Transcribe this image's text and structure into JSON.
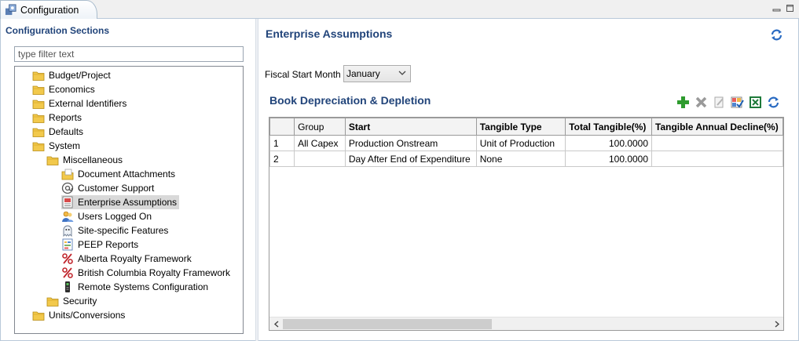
{
  "tab": {
    "label": "Configuration"
  },
  "left": {
    "section_title": "Configuration Sections",
    "filter_placeholder": "type filter text",
    "tree": [
      {
        "label": "Budget/Project",
        "icon": "folder-icon",
        "level": 0
      },
      {
        "label": "Economics",
        "icon": "folder-icon",
        "level": 0
      },
      {
        "label": "External Identifiers",
        "icon": "folder-icon",
        "level": 0
      },
      {
        "label": "Reports",
        "icon": "folder-icon",
        "level": 0
      },
      {
        "label": "Defaults",
        "icon": "folder-icon",
        "level": 0
      },
      {
        "label": "System",
        "icon": "folder-icon",
        "level": 0
      },
      {
        "label": "Miscellaneous",
        "icon": "folder-icon",
        "level": 1
      },
      {
        "label": "Document Attachments",
        "icon": "document-folder-icon",
        "level": 2
      },
      {
        "label": "Customer Support",
        "icon": "at-sign-icon",
        "level": 2
      },
      {
        "label": "Enterprise Assumptions",
        "icon": "enterprise-icon",
        "level": 2,
        "selected": true
      },
      {
        "label": "Users Logged On",
        "icon": "users-icon",
        "level": 2
      },
      {
        "label": "Site-specific Features",
        "icon": "ghost-icon",
        "level": 2
      },
      {
        "label": "PEEP Reports",
        "icon": "report-icon",
        "level": 2
      },
      {
        "label": "Alberta Royalty Framework",
        "icon": "percent-icon",
        "level": 2
      },
      {
        "label": "British Columbia Royalty Framework",
        "icon": "percent-icon",
        "level": 2
      },
      {
        "label": "Remote Systems Configuration",
        "icon": "remote-icon",
        "level": 2
      },
      {
        "label": "Security",
        "icon": "folder-icon",
        "level": 1
      },
      {
        "label": "Units/Conversions",
        "icon": "folder-icon",
        "level": 0
      }
    ]
  },
  "right": {
    "title": "Enterprise Assumptions",
    "fiscal_label": "Fiscal Start Month",
    "fiscal_value": "January",
    "book_title": "Book Depreciation & Depletion",
    "toolbar": [
      "add-icon",
      "delete-icon",
      "edit-icon",
      "grid-edit-icon",
      "excel-icon",
      "refresh-icon"
    ]
  },
  "grid": {
    "headers": [
      "",
      "Group",
      "Start",
      "Tangible Type",
      "Total Tangible(%)",
      "Tangible Annual Decline(%)"
    ],
    "rows": [
      [
        "1",
        "All Capex",
        "Production Onstream",
        "Unit of Production",
        "100.0000",
        ""
      ],
      [
        "2",
        "",
        "Day After End of Expenditure",
        "None",
        "100.0000",
        ""
      ]
    ]
  },
  "colors": {
    "title_blue": "#21447a",
    "folder_yellow": "#f2c94c",
    "selected_bg": "#d9d9d9",
    "add_green": "#2e9b2e"
  }
}
